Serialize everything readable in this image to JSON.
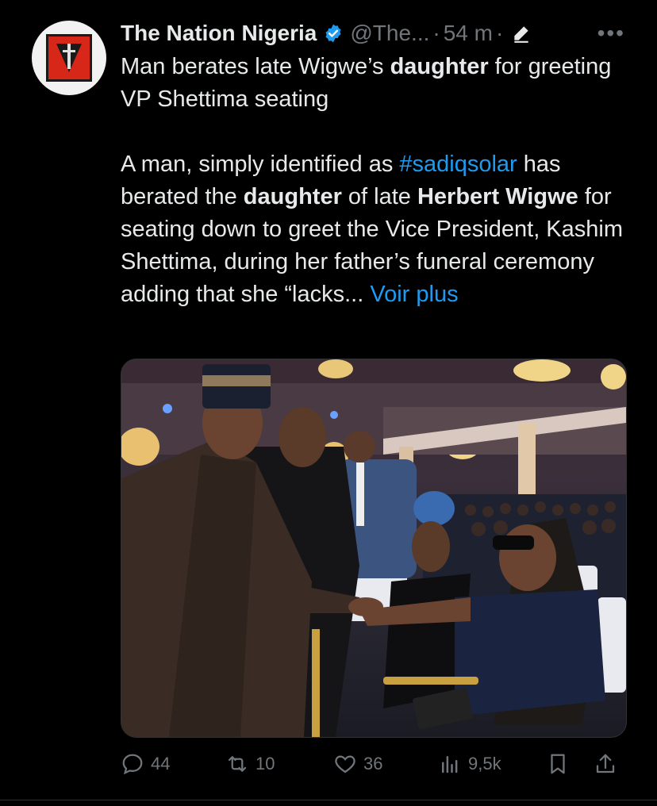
{
  "tweet": {
    "author_name": "The Nation Nigeria",
    "handle": "@The...",
    "separator": "·",
    "time": "54 m",
    "more_label": "•••",
    "avatar_icon": "the-nation-logo",
    "verified_icon": "verified-badge-icon",
    "edit_icon": "pen-icon",
    "headline_part1": "Man berates late Wigwe’s ",
    "headline_bold": "daughter",
    "headline_part2": " for greeting VP Shettima seating",
    "body_part1": "A man, simply identified as ",
    "hashtag": "#sadiqsolar",
    "body_part2": " has berated the ",
    "body_bold1": "daughter",
    "body_part3": " of late ",
    "body_bold2": "Herbert Wigwe",
    "body_part4": " for seating down to greet the Vice President, Kashim Shettima, during her father’s funeral ceremony adding that she “lacks... ",
    "see_more": "Voir plus",
    "media_description": "photo"
  },
  "actions": {
    "replies": "44",
    "reposts": "10",
    "likes": "36",
    "views": "9,5k"
  },
  "colors": {
    "background": "#000000",
    "text": "#e7e9ea",
    "muted": "#71767b",
    "link": "#1d9bf0",
    "verified": "#1d9bf0",
    "avatar_red": "#d62718"
  }
}
